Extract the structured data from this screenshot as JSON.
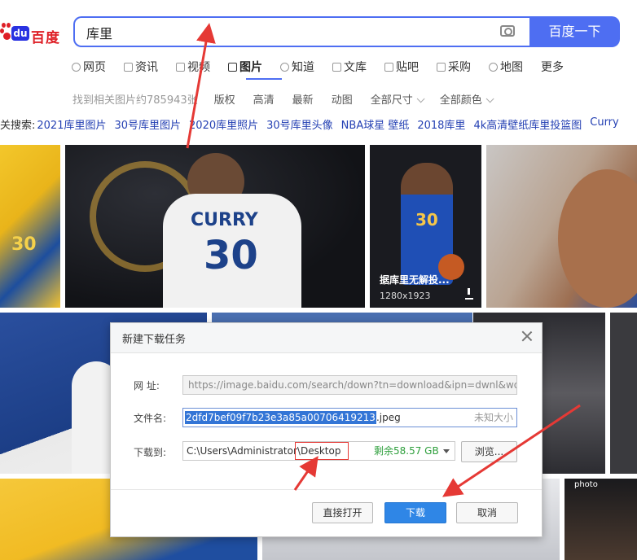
{
  "search": {
    "logo_text": "百度",
    "logo_du": "du",
    "query": "库里",
    "button": "百度一下"
  },
  "nav": {
    "items": [
      {
        "label": "网页",
        "icon": "search-icon"
      },
      {
        "label": "资讯",
        "icon": "news-icon"
      },
      {
        "label": "视频",
        "icon": "video-icon"
      },
      {
        "label": "图片",
        "icon": "image-icon",
        "active": true
      },
      {
        "label": "知道",
        "icon": "question-icon"
      },
      {
        "label": "文库",
        "icon": "doc-icon"
      },
      {
        "label": "贴吧",
        "icon": "tieba-icon"
      },
      {
        "label": "采购",
        "icon": "cart-icon"
      },
      {
        "label": "地图",
        "icon": "map-icon"
      },
      {
        "label": "更多",
        "icon": ""
      }
    ]
  },
  "filters": {
    "result_count": "找到相关图片约785943张",
    "items": [
      "版权",
      "高清",
      "最新",
      "动图",
      "全部尺寸",
      "全部颜色"
    ]
  },
  "related": {
    "label": "关搜索:",
    "items": [
      "2021库里图片",
      "30号库里图片",
      "2020库里照片",
      "30号库里头像",
      "NBA球星 壁纸",
      "2018库里",
      "4k高清壁纸库里投篮图",
      "Curry"
    ]
  },
  "images": {
    "card3_caption": "据库里无解投...",
    "card3_size": "1280x1923",
    "jersey_name": "CURRY",
    "jersey_number": "30",
    "photo_watermark": "photo"
  },
  "dialog": {
    "title": "新建下载任务",
    "url_label": "网  址:",
    "url_value": "https://image.baidu.com/search/down?tn=download&ipn=dwnl&wo",
    "filename_label": "文件名:",
    "filename_selected": "2dfd7bef09f7b23e3a85a00706419213",
    "filename_ext": ".jpeg",
    "filename_size": "未知大小",
    "saveto_label": "下载到:",
    "saveto_value": "C:\\Users\\Administrator\\Desktop",
    "free_space": "剩余58.57 GB",
    "browse_button": "浏览...",
    "open_button": "直接打开",
    "download_button": "下载",
    "cancel_button": "取消"
  },
  "colors": {
    "accent": "#4e6ef2",
    "annotation_red": "#e53935",
    "download_blue": "#2f86e6"
  }
}
